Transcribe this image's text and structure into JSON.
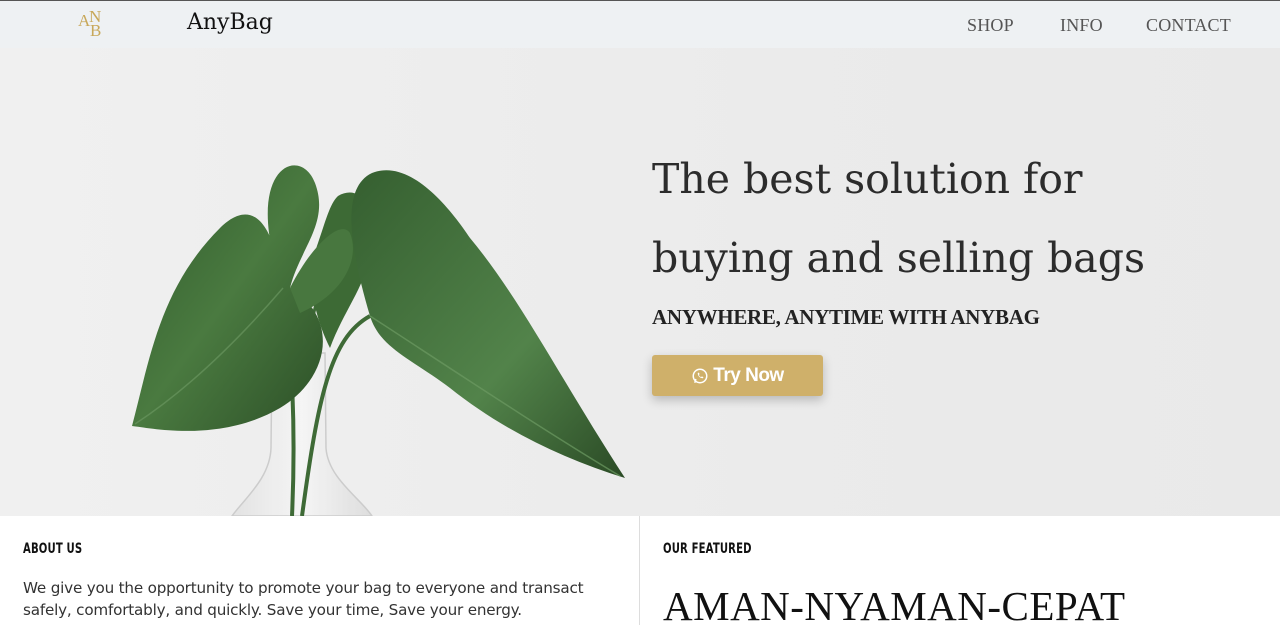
{
  "navbar": {
    "logo_letters": [
      "A",
      "N",
      "B"
    ],
    "brand": "AnyBag",
    "links": {
      "shop": "SHOP",
      "info": "INFO",
      "contact": "CONTACT"
    }
  },
  "hero": {
    "title_line1": "The best solution for",
    "title_line2": "buying and selling bags",
    "subtitle": "ANYWHERE, ANYTIME WITH ANYBAG",
    "cta_label": "Try Now",
    "cta_icon": "whatsapp-icon",
    "image": "plant-in-glass-vase"
  },
  "about": {
    "heading": "ABOUT US",
    "text": "We give you the opportunity to promote your bag to everyone and transact safely, comfortably, and quickly. Save your time, Save your energy."
  },
  "featured": {
    "heading": "OUR FEATURED",
    "tagline": "AMAN-NYAMAN-CEPAT"
  },
  "colors": {
    "accent": "#cfb06a",
    "navbar_bg": "#eef1f3",
    "hero_bg": "#ebebeb",
    "leaf": "#3d6a35"
  }
}
